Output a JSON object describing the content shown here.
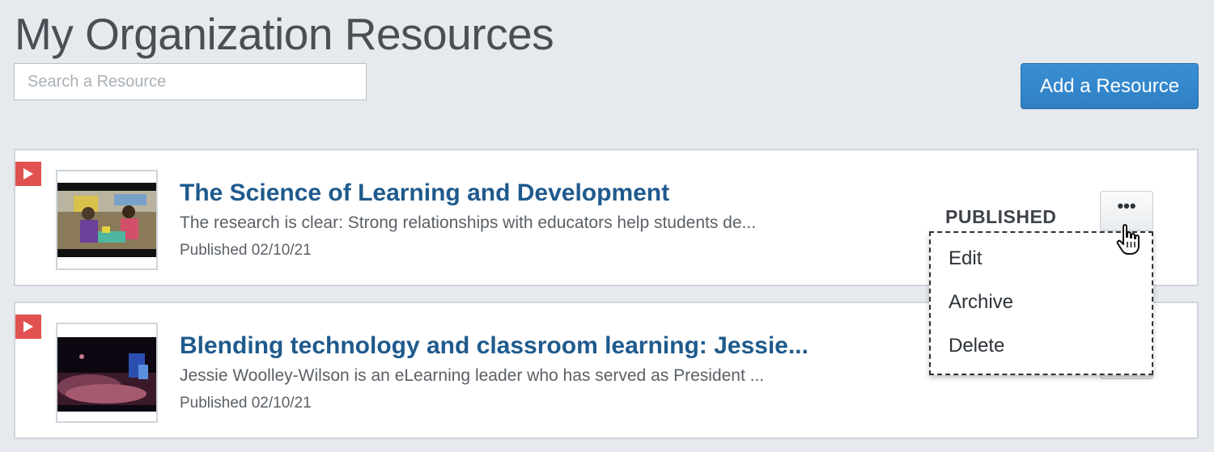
{
  "page": {
    "title": "My Organization Resources"
  },
  "search": {
    "placeholder": "Search a Resource",
    "value": ""
  },
  "toolbar": {
    "add_label": "Add a Resource"
  },
  "resources": [
    {
      "title": "The Science of Learning and Development",
      "description": "The research is clear: Strong relationships with educators help students de...",
      "date": "Published 02/10/21",
      "status": "PUBLISHED",
      "more_label": "•••"
    },
    {
      "title": "Blending technology and classroom learning: Jessie...",
      "description": "Jessie Woolley-Wilson is an eLearning leader who has served as President ...",
      "date": "Published 02/10/21",
      "status": "",
      "more_label": ""
    }
  ],
  "menu": {
    "items": [
      "Edit",
      "Archive",
      "Delete"
    ]
  },
  "icons": {
    "play": "play-icon",
    "more": "more-dots-icon",
    "cursor": "hand-pointer-icon"
  },
  "colors": {
    "accent": "#2f7fc4",
    "title": "#1f5a8d",
    "play": "#e0524f",
    "background": "#e6e9ed"
  }
}
